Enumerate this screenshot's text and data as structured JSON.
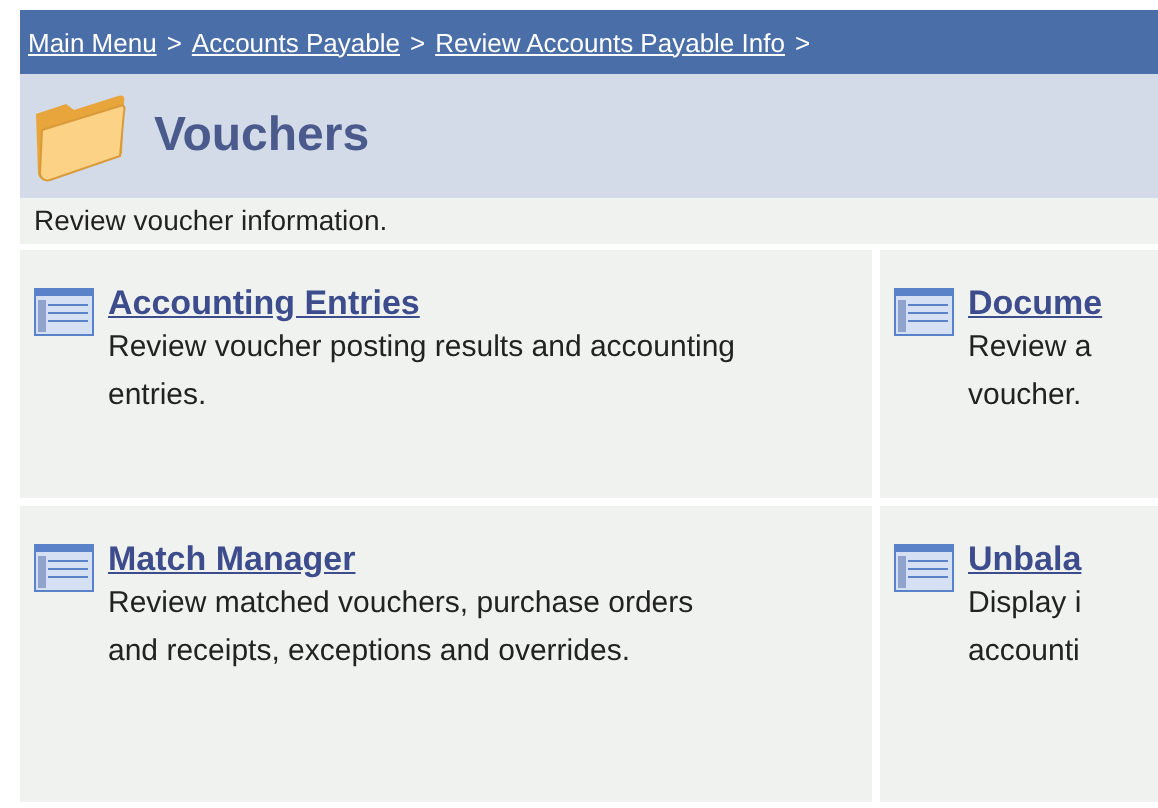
{
  "breadcrumb": [
    {
      "label": "Main Menu",
      "separator": ">"
    },
    {
      "label": "Accounts Payable",
      "separator": ">"
    },
    {
      "label": "Review Accounts Payable Info",
      "separator": ">"
    }
  ],
  "title": "Vouchers",
  "description": "Review voucher information.",
  "cards": [
    [
      {
        "title": "Accounting Entries",
        "description": "Review voucher posting results and accounting entries."
      },
      {
        "title": "Docume",
        "description": "Review a voucher."
      }
    ],
    [
      {
        "title": "Match Manager",
        "description": "Review matched vouchers, purchase orders and receipts, exceptions and overrides."
      },
      {
        "title": "Unbala",
        "description": "Display i accounti"
      }
    ]
  ]
}
